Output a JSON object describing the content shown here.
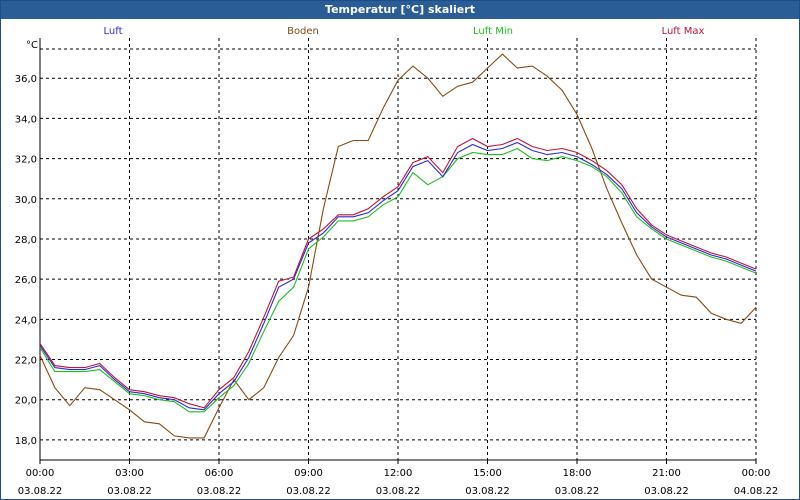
{
  "window": {
    "title": "Temperatur [°C] skaliert"
  },
  "colors": {
    "luft": "#2b2bd0",
    "boden": "#8b4a13",
    "luft_min": "#1fbf1f",
    "luft_max": "#c0143a"
  },
  "chart_data": {
    "type": "line",
    "title": "Temperatur [°C] skaliert",
    "ylabel": "°C",
    "ylim": [
      17.0,
      38.0
    ],
    "xlim": [
      "03.08.22 00:00",
      "04.08.22 00:00"
    ],
    "x_ticks": [
      {
        "time": "00:00",
        "date": "03.08.22"
      },
      {
        "time": "03:00",
        "date": "03.08.22"
      },
      {
        "time": "06:00",
        "date": "03.08.22"
      },
      {
        "time": "09:00",
        "date": "03.08.22"
      },
      {
        "time": "12:00",
        "date": "03.08.22"
      },
      {
        "time": "15:00",
        "date": "03.08.22"
      },
      {
        "time": "18:00",
        "date": "03.08.22"
      },
      {
        "time": "21:00",
        "date": "03.08.22"
      },
      {
        "time": "00:00",
        "date": "04.08.22"
      }
    ],
    "y_ticks": [
      "18,0",
      "20,0",
      "22,0",
      "24,0",
      "26,0",
      "28,0",
      "30,0",
      "32,0",
      "34,0",
      "36,0"
    ],
    "grid": true,
    "legend": "top",
    "x_hours": [
      0,
      0.5,
      1,
      1.5,
      2,
      2.5,
      3,
      3.5,
      4,
      4.5,
      5,
      5.5,
      6,
      6.5,
      7,
      7.5,
      8,
      8.5,
      9,
      9.5,
      10,
      10.5,
      11,
      11.5,
      12,
      12.5,
      13,
      13.5,
      14,
      14.5,
      15,
      15.5,
      16,
      16.5,
      17,
      17.5,
      18,
      18.5,
      19,
      19.5,
      20,
      20.5,
      21,
      21.5,
      22,
      22.5,
      23,
      23.5,
      24
    ],
    "series": [
      {
        "name": "Luft",
        "values": [
          22.7,
          21.6,
          21.5,
          21.5,
          21.7,
          21.0,
          20.4,
          20.3,
          20.1,
          20.0,
          19.6,
          19.5,
          20.3,
          20.9,
          22.1,
          23.8,
          25.6,
          26.0,
          27.8,
          28.3,
          29.1,
          29.1,
          29.3,
          29.9,
          30.4,
          31.6,
          31.9,
          31.1,
          32.3,
          32.7,
          32.4,
          32.5,
          32.8,
          32.4,
          32.2,
          32.3,
          32.1,
          31.7,
          31.2,
          30.5,
          29.3,
          28.6,
          28.1,
          27.8,
          27.5,
          27.2,
          27.0,
          26.7,
          26.4
        ]
      },
      {
        "name": "Boden",
        "values": [
          22.2,
          20.6,
          19.7,
          20.6,
          20.5,
          20.0,
          19.5,
          18.9,
          18.8,
          18.2,
          18.1,
          18.1,
          19.6,
          21.0,
          20.0,
          20.6,
          22.1,
          23.2,
          25.6,
          29.5,
          32.6,
          32.9,
          32.9,
          34.5,
          35.9,
          36.6,
          36.0,
          35.1,
          35.6,
          35.8,
          36.5,
          37.2,
          36.5,
          36.6,
          36.1,
          35.4,
          34.2,
          32.5,
          30.5,
          28.8,
          27.2,
          26.0,
          25.6,
          25.2,
          25.1,
          24.3,
          24.0,
          23.8,
          24.6
        ]
      },
      {
        "name": "Luft Min",
        "values": [
          22.6,
          21.4,
          21.4,
          21.4,
          21.5,
          20.9,
          20.3,
          20.2,
          20.0,
          19.9,
          19.4,
          19.4,
          20.1,
          20.7,
          21.8,
          23.4,
          24.9,
          25.6,
          27.5,
          28.1,
          28.9,
          28.9,
          29.1,
          29.7,
          30.1,
          31.3,
          30.7,
          31.1,
          32.0,
          32.3,
          32.2,
          32.2,
          32.5,
          32.0,
          31.9,
          32.1,
          31.9,
          31.6,
          31.1,
          30.3,
          29.1,
          28.5,
          28.0,
          27.7,
          27.4,
          27.1,
          26.9,
          26.6,
          26.3
        ]
      },
      {
        "name": "Luft Max",
        "values": [
          22.8,
          21.7,
          21.6,
          21.6,
          21.8,
          21.1,
          20.5,
          20.4,
          20.2,
          20.1,
          19.8,
          19.6,
          20.5,
          21.1,
          22.4,
          24.1,
          25.9,
          26.1,
          28.0,
          28.5,
          29.2,
          29.2,
          29.5,
          30.1,
          30.6,
          31.8,
          32.1,
          31.3,
          32.6,
          33.0,
          32.6,
          32.7,
          33.0,
          32.6,
          32.4,
          32.5,
          32.3,
          31.9,
          31.4,
          30.7,
          29.5,
          28.7,
          28.2,
          27.9,
          27.6,
          27.3,
          27.1,
          26.8,
          26.5
        ]
      }
    ]
  }
}
